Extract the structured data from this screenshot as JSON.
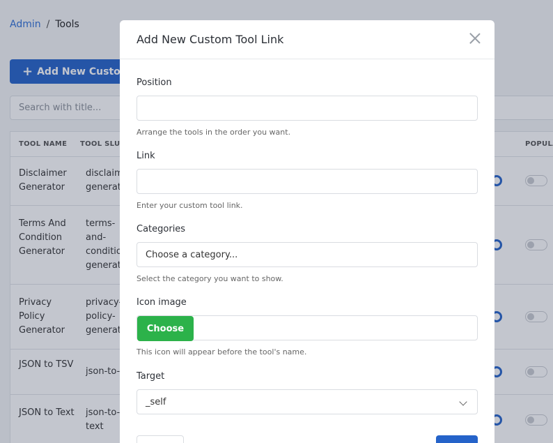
{
  "breadcrumb": {
    "link": "Admin",
    "separator": "/",
    "current": "Tools"
  },
  "add_button": {
    "label": "Add New Custom T"
  },
  "search": {
    "placeholder": "Search with title..."
  },
  "table": {
    "headers": {
      "name": "TOOL NAME",
      "slug": "TOOL SLUG",
      "popular": "POPULA"
    },
    "rows": [
      {
        "name": "Disclaimer Generator",
        "slug": "disclaim generato"
      },
      {
        "name": "Terms And Condition Generator",
        "slug": "terms- and- conditio generato"
      },
      {
        "name": "Privacy Policy Generator",
        "slug": "privacy- policy- generato"
      },
      {
        "name": "JSON to TSV",
        "slug": "json-to-"
      },
      {
        "name": "JSON to Text",
        "slug": "json-to- text"
      }
    ]
  },
  "modal": {
    "title": "Add New Custom Tool Link",
    "close_icon": "close-icon",
    "position": {
      "label": "Position",
      "value": "",
      "help": "Arrange the tools in the order you want."
    },
    "link": {
      "label": "Link",
      "value": "",
      "help": "Enter your custom tool link."
    },
    "categories": {
      "label": "Categories",
      "value": "Choose a category...",
      "help": "Select the category you want to show."
    },
    "icon_image": {
      "label": "Icon image",
      "button": "Choose",
      "help": "This icon will appear before the tool's name."
    },
    "target": {
      "label": "Target",
      "value": "_self"
    }
  },
  "colors": {
    "primary": "#2563c9",
    "success": "#2cb24a",
    "overlay": "rgba(40,50,80,0.28)"
  }
}
